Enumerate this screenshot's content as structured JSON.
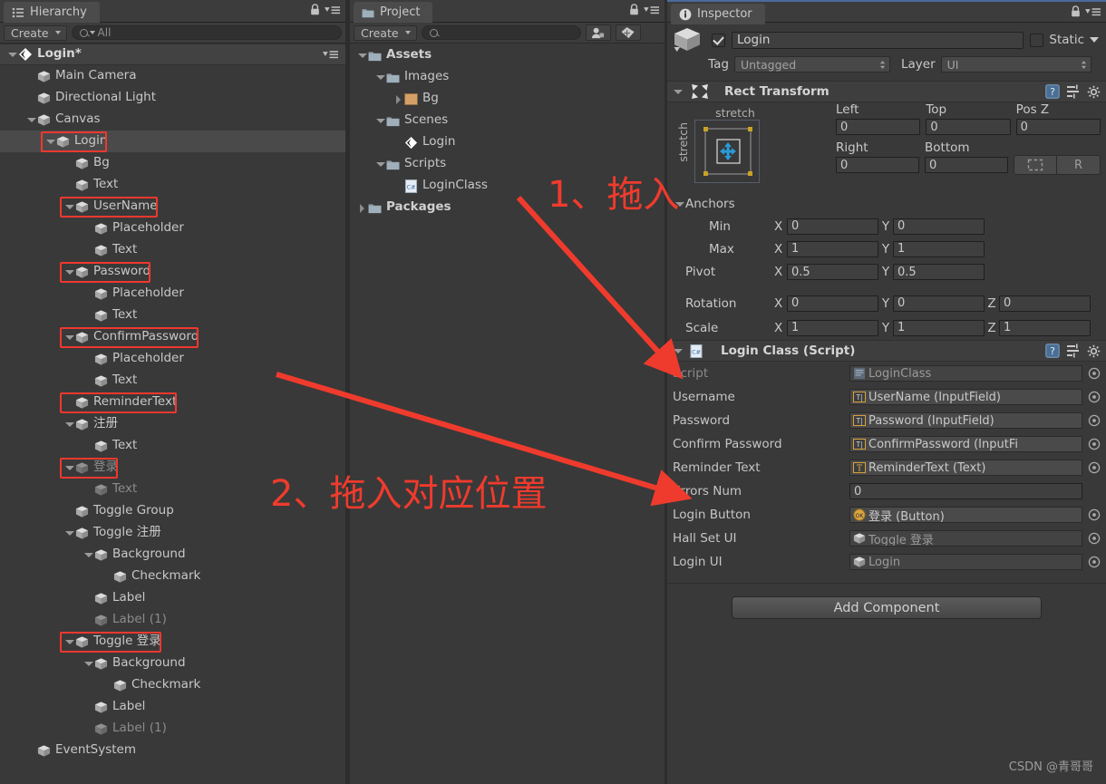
{
  "hierarchy": {
    "tab_label": "Hierarchy",
    "tab_icon": "hierarchy-list-icon",
    "create_label": "Create",
    "search_placeholder": "All",
    "scene_name": "Login*",
    "items": [
      {
        "label": "Main Camera",
        "depth": 1,
        "arrow": "none",
        "dim": false
      },
      {
        "label": "Directional Light",
        "depth": 1,
        "arrow": "none",
        "dim": false
      },
      {
        "label": "Canvas",
        "depth": 1,
        "arrow": "down",
        "dim": false
      },
      {
        "label": "Login",
        "depth": 2,
        "arrow": "down",
        "dim": false,
        "selected": true,
        "boxed": true
      },
      {
        "label": "Bg",
        "depth": 3,
        "arrow": "none",
        "dim": false
      },
      {
        "label": "Text",
        "depth": 3,
        "arrow": "none",
        "dim": false
      },
      {
        "label": "UserName",
        "depth": 3,
        "arrow": "down",
        "dim": false,
        "boxed": true
      },
      {
        "label": "Placeholder",
        "depth": 4,
        "arrow": "none",
        "dim": false
      },
      {
        "label": "Text",
        "depth": 4,
        "arrow": "none",
        "dim": false
      },
      {
        "label": "Password",
        "depth": 3,
        "arrow": "down",
        "dim": false,
        "boxed": true
      },
      {
        "label": "Placeholder",
        "depth": 4,
        "arrow": "none",
        "dim": false
      },
      {
        "label": "Text",
        "depth": 4,
        "arrow": "none",
        "dim": false
      },
      {
        "label": "ConfirmPassword",
        "depth": 3,
        "arrow": "down",
        "dim": false,
        "boxed": true
      },
      {
        "label": "Placeholder",
        "depth": 4,
        "arrow": "none",
        "dim": false
      },
      {
        "label": "Text",
        "depth": 4,
        "arrow": "none",
        "dim": false
      },
      {
        "label": "ReminderText",
        "depth": 3,
        "arrow": "none",
        "dim": false,
        "boxed": true
      },
      {
        "label": "注册",
        "depth": 3,
        "arrow": "down",
        "dim": false
      },
      {
        "label": "Text",
        "depth": 4,
        "arrow": "none",
        "dim": false
      },
      {
        "label": "登录",
        "depth": 3,
        "arrow": "down",
        "dim": true,
        "boxed": true
      },
      {
        "label": "Text",
        "depth": 4,
        "arrow": "none",
        "dim": true
      },
      {
        "label": "Toggle Group",
        "depth": 3,
        "arrow": "none",
        "dim": false
      },
      {
        "label": "Toggle 注册",
        "depth": 3,
        "arrow": "down",
        "dim": false
      },
      {
        "label": "Background",
        "depth": 4,
        "arrow": "down",
        "dim": false
      },
      {
        "label": "Checkmark",
        "depth": 5,
        "arrow": "none",
        "dim": false
      },
      {
        "label": "Label",
        "depth": 4,
        "arrow": "none",
        "dim": false
      },
      {
        "label": "Label (1)",
        "depth": 4,
        "arrow": "none",
        "dim": true
      },
      {
        "label": "Toggle 登录",
        "depth": 3,
        "arrow": "down",
        "dim": false,
        "boxed": true
      },
      {
        "label": "Background",
        "depth": 4,
        "arrow": "down",
        "dim": false
      },
      {
        "label": "Checkmark",
        "depth": 5,
        "arrow": "none",
        "dim": false
      },
      {
        "label": "Label",
        "depth": 4,
        "arrow": "none",
        "dim": false
      },
      {
        "label": "Label (1)",
        "depth": 4,
        "arrow": "none",
        "dim": true
      },
      {
        "label": "EventSystem",
        "depth": 1,
        "arrow": "none",
        "dim": false
      }
    ]
  },
  "project": {
    "tab_label": "Project",
    "tab_icon": "folder-icon",
    "create_label": "Create",
    "search_placeholder": "",
    "filter_type_icon": "filter-by-type-icon",
    "filter_label_icon": "filter-by-label-icon",
    "items": [
      {
        "label": "Assets",
        "depth": 0,
        "arrow": "down",
        "icon": "folder",
        "bold": true
      },
      {
        "label": "Images",
        "depth": 1,
        "arrow": "down",
        "icon": "folder",
        "bold": false
      },
      {
        "label": "Bg",
        "depth": 2,
        "arrow": "right",
        "icon": "texture",
        "bold": false
      },
      {
        "label": "Scenes",
        "depth": 1,
        "arrow": "down",
        "icon": "folder",
        "bold": false
      },
      {
        "label": "Login",
        "depth": 2,
        "arrow": "none",
        "icon": "unity",
        "bold": false
      },
      {
        "label": "Scripts",
        "depth": 1,
        "arrow": "down",
        "icon": "folder",
        "bold": false
      },
      {
        "label": "LoginClass",
        "depth": 2,
        "arrow": "none",
        "icon": "csharp",
        "bold": false
      },
      {
        "label": "Packages",
        "depth": 0,
        "arrow": "right",
        "icon": "folder",
        "bold": true
      }
    ]
  },
  "inspector": {
    "tab_label": "Inspector",
    "tab_icon": "info-icon",
    "object_enabled": true,
    "object_name": "Login",
    "static_label": "Static",
    "tag_label": "Tag",
    "tag_value": "Untagged",
    "layer_label": "Layer",
    "layer_value": "UI",
    "rect_transform": {
      "title": "Rect Transform",
      "anchor_preset_top": "stretch",
      "anchor_preset_left": "stretch",
      "fields": [
        {
          "label": "Left",
          "value": "0"
        },
        {
          "label": "Top",
          "value": "0"
        },
        {
          "label": "Pos Z",
          "value": "0"
        },
        {
          "label": "Right",
          "value": "0"
        },
        {
          "label": "Bottom",
          "value": "0"
        }
      ],
      "blueprint_button": "blueprint-icon",
      "raw_button": "R",
      "anchors_label": "Anchors",
      "min_label": "Min",
      "min_x": "0",
      "min_y": "0",
      "max_label": "Max",
      "max_x": "1",
      "max_y": "1",
      "pivot_label": "Pivot",
      "pivot_x": "0.5",
      "pivot_y": "0.5",
      "rotation_label": "Rotation",
      "rot_x": "0",
      "rot_y": "0",
      "rot_z": "0",
      "scale_label": "Scale",
      "scale_x": "1",
      "scale_y": "1",
      "scale_z": "1"
    },
    "login_class": {
      "title": "Login Class (Script)",
      "rows": [
        {
          "label": "Script",
          "value": "LoginClass",
          "icon": "cs-asset",
          "dim": true,
          "picker": true
        },
        {
          "label": "Username",
          "value": "UserName (InputField)",
          "icon": "inputfield",
          "dim": false,
          "picker": true
        },
        {
          "label": "Password",
          "value": "Password (InputField)",
          "icon": "inputfield",
          "dim": false,
          "picker": true
        },
        {
          "label": "Confirm Password",
          "value": "ConfirmPassword (InputFi",
          "icon": "inputfield",
          "dim": false,
          "picker": true
        },
        {
          "label": "Reminder Text",
          "value": "ReminderText (Text)",
          "icon": "text",
          "dim": false,
          "picker": true
        },
        {
          "label": "Errors Num",
          "value": "0",
          "icon": "none",
          "dim": false,
          "picker": false
        },
        {
          "label": "Login Button",
          "value": "登录 (Button)",
          "icon": "button",
          "dim": false,
          "picker": true
        },
        {
          "label": "Hall Set UI",
          "value": "Toggle 登录",
          "icon": "gameobject",
          "dim": true,
          "picker": true
        },
        {
          "label": "Login UI",
          "value": "Login",
          "icon": "gameobject",
          "dim": true,
          "picker": true
        }
      ]
    },
    "add_component_label": "Add Component"
  },
  "annotations": [
    {
      "id": "step1",
      "text": "1、拖入"
    },
    {
      "id": "step2",
      "text": "2、拖入对应位置"
    }
  ],
  "watermark": "CSDN @青哥哥",
  "colors": {
    "accent_red": "#ef3b2d",
    "panel_bg": "#393939",
    "selected_row": "#4a4a4a"
  }
}
